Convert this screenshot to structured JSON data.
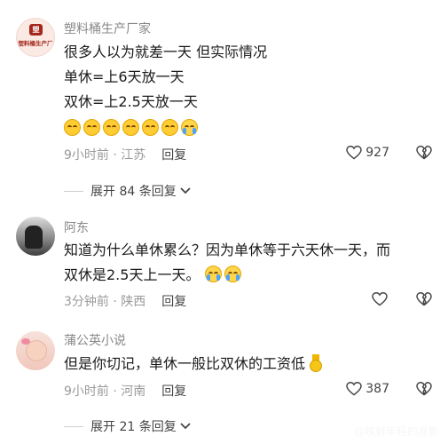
{
  "comments": [
    {
      "username": "塑料桶生产厂家",
      "avatar_text": "塑料桶生产厂",
      "avatar_badge": "塑",
      "lines": [
        "很多人以为就差一天  但实际情况",
        "单休=上6天放一天",
        "双休=上2.5天放一天"
      ],
      "emoji_row": [
        "grin-emoji",
        "grin-emoji",
        "grin-emoji",
        "grin-emoji",
        "grin-emoji",
        "grin-emoji",
        "laugh-cry-emoji"
      ],
      "time_location": "9小时前 · 江苏",
      "reply_label": "回复",
      "likes": "927",
      "expand_label": "展开 84 条回复"
    },
    {
      "username": "阿东",
      "lines": [
        "知道为什么单休累么？因为单休等于六天休一天，而",
        "双休是2.5天上一天。"
      ],
      "time_location": "3分钟前 · 陕西",
      "reply_label": "回复",
      "likes": ""
    },
    {
      "username": "蒲公英小说",
      "lines": [
        "但是你切记，单休一般比双休的工资低"
      ],
      "time_location": "9小时前 · 河南",
      "reply_label": "回复",
      "likes": "387",
      "expand_label": "展开 21 条回复"
    }
  ],
  "watermark": "@映射年轻的身影",
  "colors": {
    "text": "#1a1a1a",
    "username": "#888888",
    "meta": "#9a9a9a",
    "emoji": "#ffcc33",
    "avatar_badge": "#a3271d"
  }
}
